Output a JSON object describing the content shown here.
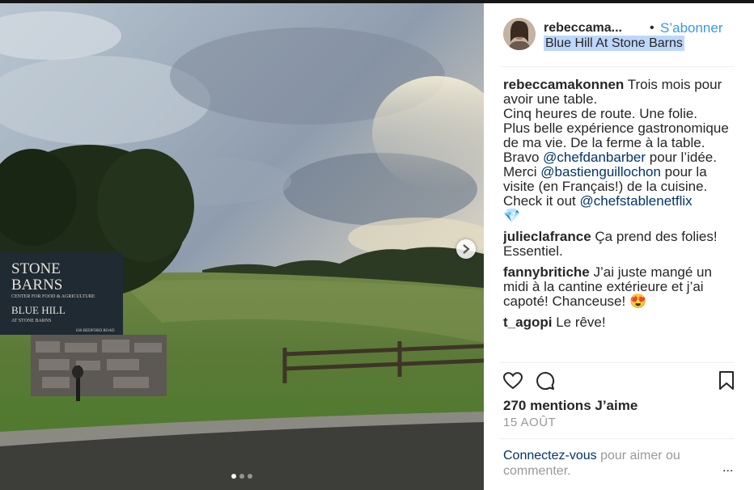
{
  "post": {
    "username": "rebeccama...",
    "separator": "•",
    "follow_label": "S’abonner",
    "location": "Blue Hill At Stone Barns",
    "caption": {
      "user": "rebeccamakonnen",
      "line1": "Trois mois pour avoir une table.",
      "line2": "Cinq heures de route. Une folie.",
      "line3": "Plus belle expérience gastronomique de ma vie. De la ferme à la table.",
      "bravo": "Bravo",
      "mention1": "@chefdanbarber",
      "bravo_end": "pour l’idée.",
      "merci": "Merci",
      "mention2": "@bastienguillochon",
      "merci_end": "pour la visite (en Français!) de la cuisine.",
      "check": "Check it out",
      "mention3": "@chefstablenetflix",
      "emoji": "💎"
    },
    "comments": [
      {
        "user": "julieclafrance",
        "text": "Ça prend des folies! Essentiel."
      },
      {
        "user": "fannybritiche",
        "text": "J’ai juste mangé un midi à la cantine extérieure et j’ai capoté! Chanceuse! 😍"
      },
      {
        "user": "t_agopi",
        "text": "Le rêve!"
      }
    ],
    "likes": "270 mentions J’aime",
    "date": "15 AOÛT",
    "login_link": "Connectez-vous",
    "login_text": "pour aimer ou commenter.",
    "more": "...",
    "sign": {
      "line1": "STONE",
      "line2": "BARNS",
      "line3": "CENTER FOR FOOD & AGRICULTURE",
      "line4": "BLUE HILL",
      "line5": "AT STONE BARNS",
      "line6": "630 BEDFORD ROAD"
    },
    "icons": [
      "heart-icon",
      "comment-icon",
      "bookmark-icon",
      "chevron-right-icon"
    ],
    "carousel": {
      "count": 3,
      "active": 1
    }
  },
  "colors": {
    "accent": "#3897f0",
    "link": "#003569",
    "muted": "#999999"
  }
}
